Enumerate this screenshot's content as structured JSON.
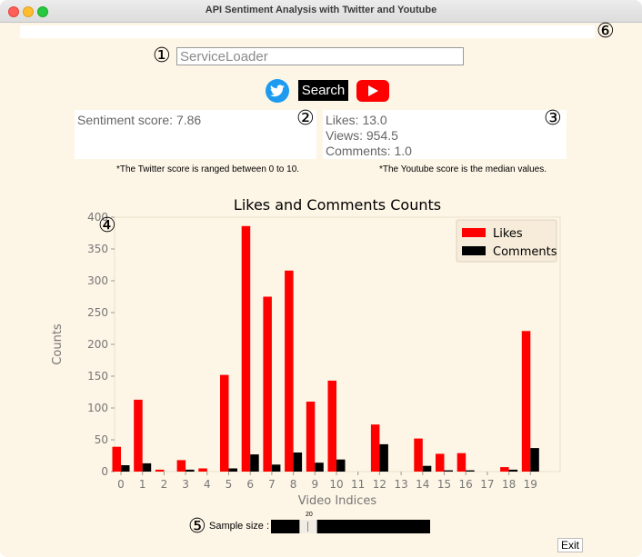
{
  "window": {
    "title": "API Sentiment Analysis with Twitter and Youtube"
  },
  "markers": [
    "①",
    "②",
    "③",
    "④",
    "⑤",
    "⑥"
  ],
  "search": {
    "value": "ServiceLoader"
  },
  "buttons": {
    "search_label": "Search",
    "twitter_icon": "twitter-bird-icon",
    "youtube_icon": "youtube-play-icon",
    "exit_label": "Exit"
  },
  "twitter_box": {
    "score_text": "Sentiment score: 7.86",
    "note": "*The Twitter score is ranged between 0 to 10."
  },
  "youtube_box": {
    "likes": "Likes: 13.0",
    "views": "Views: 954.5",
    "comments": "Comments: 1.0",
    "note": "*The Youtube score is the median values."
  },
  "sample": {
    "label": "Sample size :",
    "value": "20",
    "min": 0,
    "max": 100
  },
  "colors": {
    "window_bg": "#fdf5e6",
    "likes": "#ff0000",
    "comments": "#000000",
    "twitter": "#1d9bf0",
    "youtube": "#ff0000"
  },
  "chart_data": {
    "type": "bar",
    "title": "Likes and Comments Counts",
    "xlabel": "Video Indices",
    "ylabel": "Counts",
    "categories": [
      "0",
      "1",
      "2",
      "3",
      "4",
      "5",
      "6",
      "7",
      "8",
      "9",
      "10",
      "11",
      "12",
      "13",
      "14",
      "15",
      "16",
      "17",
      "18",
      "19"
    ],
    "series": [
      {
        "name": "Likes",
        "color": "#ff0000",
        "values": [
          39,
          113,
          3,
          18,
          5,
          152,
          386,
          275,
          316,
          110,
          143,
          0,
          74,
          0,
          52,
          28,
          29,
          0,
          7,
          221
        ]
      },
      {
        "name": "Comments",
        "color": "#000000",
        "values": [
          10,
          13,
          0,
          3,
          0,
          5,
          27,
          11,
          30,
          14,
          19,
          0,
          43,
          0,
          9,
          2,
          2,
          0,
          3,
          37
        ]
      }
    ],
    "yticks": [
      0,
      50,
      100,
      150,
      200,
      250,
      300,
      350,
      400
    ],
    "ylim": [
      0,
      400
    ],
    "legend": "top-right",
    "grid": false
  }
}
